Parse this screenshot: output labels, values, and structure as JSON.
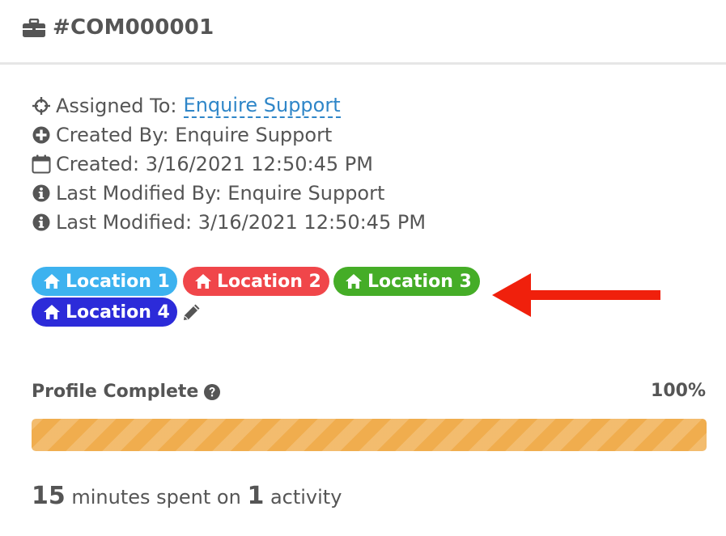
{
  "header": {
    "icon": "briefcase-icon",
    "title": "#COM000001"
  },
  "meta": {
    "assigned": {
      "icon": "crosshairs-icon",
      "label": "Assigned To:",
      "value": "Enquire Support"
    },
    "created_by": {
      "icon": "plus-circle-icon",
      "text": "Created By: Enquire Support"
    },
    "created": {
      "icon": "calendar-icon",
      "text": "Created: 3/16/2021 12:50:45 PM"
    },
    "modified_by": {
      "icon": "info-circle-icon",
      "text": "Last Modified By: Enquire Support"
    },
    "modified": {
      "icon": "info-circle-icon",
      "text": "Last Modified: 3/16/2021 12:50:45 PM"
    }
  },
  "locations": [
    {
      "label": "Location 1",
      "color": "#3db2ef",
      "icon": "home-icon"
    },
    {
      "label": "Location 2",
      "color": "#f0464a",
      "icon": "home-icon"
    },
    {
      "label": "Location 3",
      "color": "#45ad27",
      "icon": "home-icon"
    },
    {
      "label": "Location 4",
      "color": "#2c2bd9",
      "icon": "home-icon"
    }
  ],
  "edit_icon": "pencil-icon",
  "annotation": {
    "icon": "red-arrow-left",
    "color": "#f0200c"
  },
  "profile": {
    "label": "Profile Complete",
    "help_icon": "question-circle-icon",
    "percent_text": "100%",
    "percent": 100,
    "bar_color": "#f0ad4e"
  },
  "activity": {
    "minutes": "15",
    "minutes_text": " minutes spent on ",
    "count": "1",
    "count_text": " activity"
  }
}
